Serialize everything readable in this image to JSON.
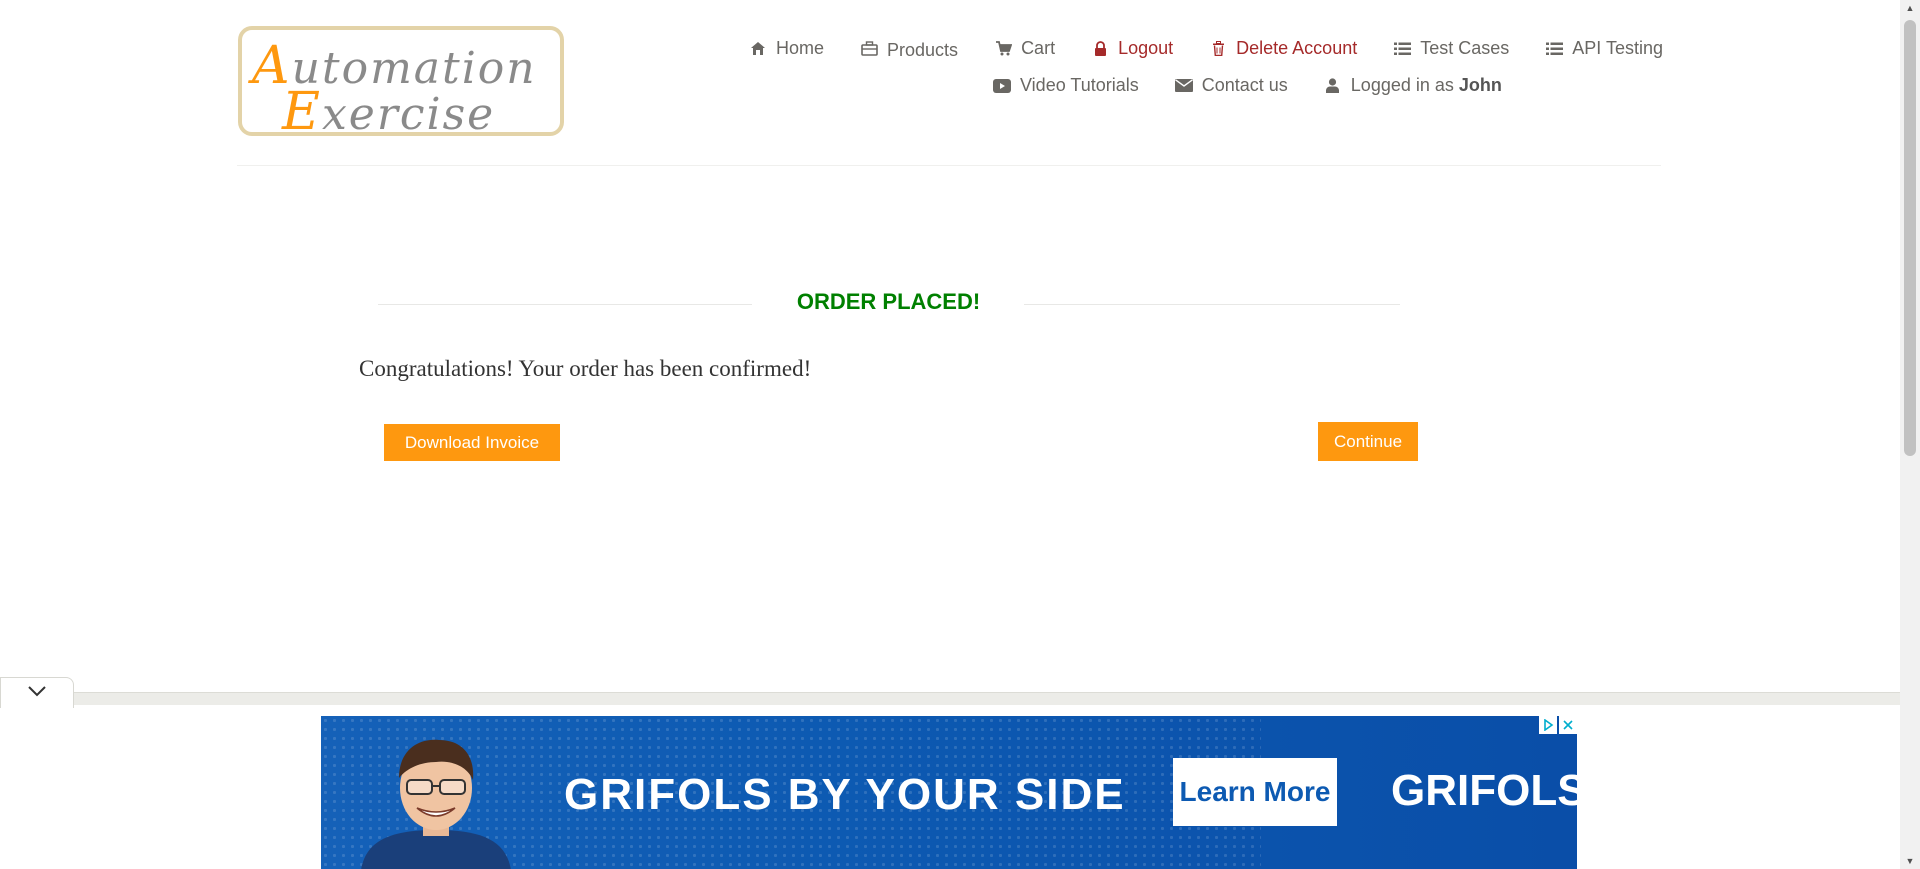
{
  "logo": {
    "line1_cap": "A",
    "line1_rest": "utomation",
    "line2_cap": "E",
    "line2_rest": "xercise"
  },
  "nav": {
    "row1": [
      {
        "label": "Home",
        "icon": "home-icon"
      },
      {
        "label": "Products",
        "icon": "products-icon"
      },
      {
        "label": "Cart",
        "icon": "cart-icon"
      },
      {
        "label": "Logout",
        "icon": "lock-icon"
      },
      {
        "label": "Delete Account",
        "icon": "trash-icon"
      },
      {
        "label": "Test Cases",
        "icon": "list-icon"
      },
      {
        "label": "API Testing",
        "icon": "list-icon"
      }
    ],
    "row2": [
      {
        "label": "Video Tutorials",
        "icon": "youtube-icon"
      },
      {
        "label": "Contact us",
        "icon": "envelope-icon"
      },
      {
        "label": "Logged in as",
        "icon": "user-icon",
        "username": "John"
      }
    ]
  },
  "order": {
    "title": "ORDER PLACED!",
    "message": "Congratulations! Your order has been confirmed!",
    "download_label": "Download Invoice",
    "continue_label": "Continue"
  },
  "ad": {
    "headline": "GRIFOLS BY YOUR SIDE",
    "cta": "Learn More",
    "brand": "GRIFOLS"
  },
  "colors": {
    "accent": "#fe980f",
    "success": "#008000",
    "danger": "#a52a2a",
    "ad_blue": "#0d5ab2"
  }
}
